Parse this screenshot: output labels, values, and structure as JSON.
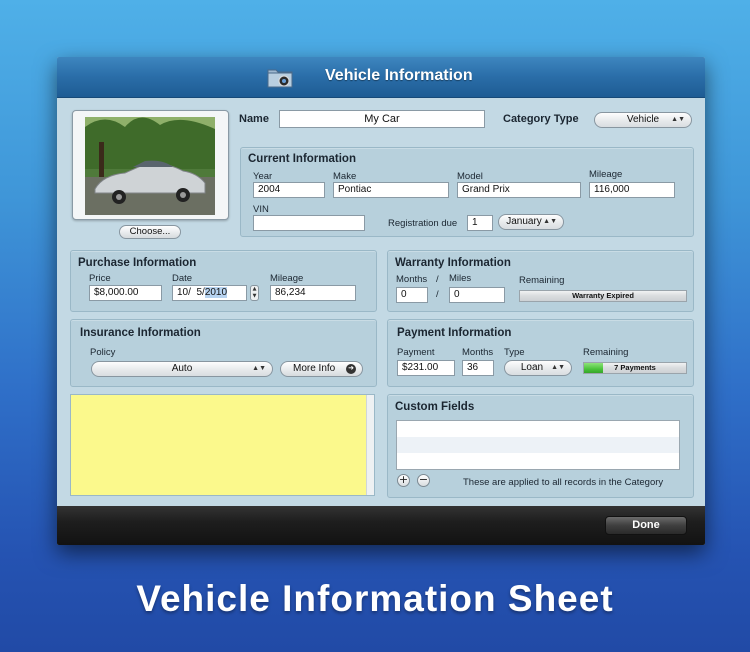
{
  "window": {
    "title": "Vehicle Information"
  },
  "photo": {
    "choose_label": "Choose..."
  },
  "header": {
    "name_label": "Name",
    "name_value": "My Car",
    "category_label": "Category Type",
    "category_value": "Vehicle"
  },
  "current": {
    "title": "Current Information",
    "year_label": "Year",
    "year": "2004",
    "make_label": "Make",
    "make": "Pontiac",
    "model_label": "Model",
    "model": "Grand Prix",
    "mileage_label": "Mileage",
    "mileage": "116,000",
    "vin_label": "VIN",
    "vin": "",
    "registration_label": "Registration due",
    "registration_day": "1",
    "registration_month": "January"
  },
  "purchase": {
    "title": "Purchase Information",
    "price_label": "Price",
    "price": "$8,000.00",
    "date_label": "Date",
    "date_prefix": "10/  5/",
    "date_year": "2010",
    "mileage_label": "Mileage",
    "mileage": "86,234"
  },
  "warranty": {
    "title": "Warranty Information",
    "months_label": "Months",
    "slash": "/",
    "miles_label": "Miles",
    "months": "0",
    "miles": "0",
    "remaining_label": "Remaining",
    "status": "Warranty Expired",
    "fill_fraction": 0
  },
  "insurance": {
    "title": "Insurance Information",
    "policy_label": "Policy",
    "policy_value": "Auto",
    "more_info_label": "More Info"
  },
  "payment": {
    "title": "Payment Information",
    "payment_label": "Payment",
    "payment": "$231.00",
    "months_label": "Months",
    "months": "36",
    "type_label": "Type",
    "type": "Loan",
    "remaining_label": "Remaining",
    "remaining_text": "7 Payments",
    "fill_fraction": 0.19
  },
  "custom": {
    "title": "Custom Fields",
    "note": "These are applied to all records in the Category",
    "add_symbol": "+",
    "remove_symbol": "−"
  },
  "footer": {
    "done_label": "Done"
  },
  "caption": "Vehicle Information Sheet",
  "colors": {
    "notes_yellow": "#fbf98c",
    "titlebar": "#2a6da8",
    "progress_green": "#4bc43b"
  }
}
